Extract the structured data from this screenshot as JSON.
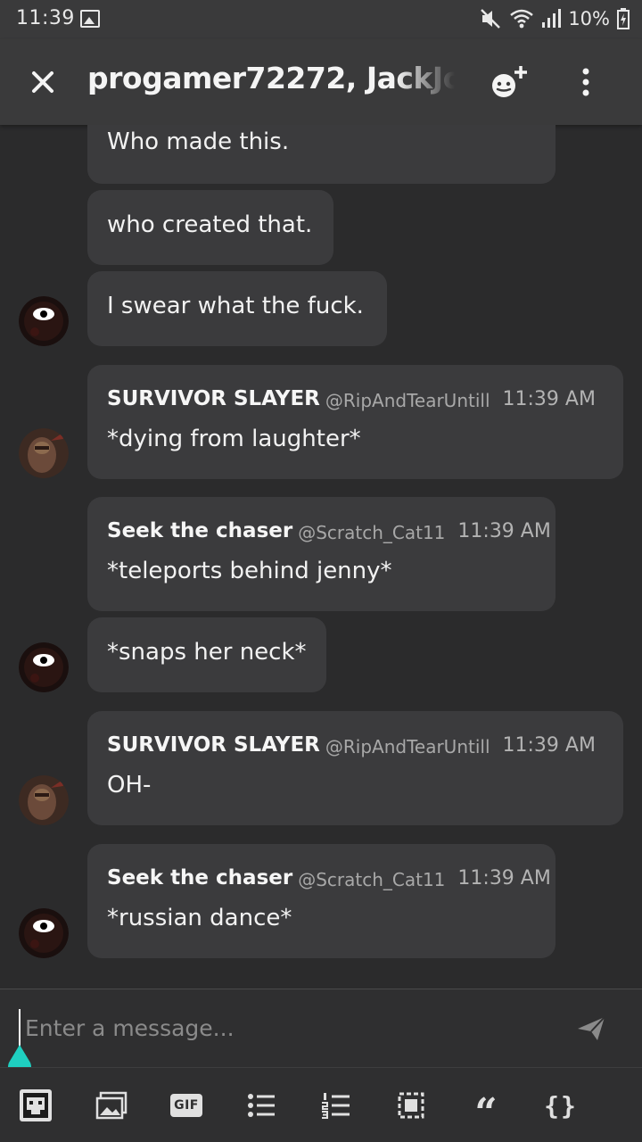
{
  "status_bar": {
    "time": "11:39",
    "battery": "10%"
  },
  "header": {
    "title": "progamer72272, JackJo",
    "icons": [
      "close-icon",
      "add-member-icon",
      "more-vert-icon"
    ]
  },
  "messages": [
    {
      "text": "Who made this."
    },
    {
      "text": "who created that."
    },
    {
      "text": "I swear what the fuck."
    },
    {
      "author": "SURVIVOR SLAYER",
      "handle": "@RipAndTearUntill",
      "time": "11:39 AM",
      "text": "*dying from laughter*"
    },
    {
      "author": "Seek the chaser",
      "handle": "@Scratch_Cat11",
      "time": "11:39 AM",
      "text": "*teleports behind jenny*"
    },
    {
      "text": "*snaps her neck*"
    },
    {
      "author": "SURVIVOR SLAYER",
      "handle": "@RipAndTearUntill",
      "time": "11:39 AM",
      "text": "OH-"
    },
    {
      "author": "Seek the chaser",
      "handle": "@Scratch_Cat11",
      "time": "11:39 AM",
      "text": "*russian dance*"
    }
  ],
  "composer": {
    "placeholder": "Enter a message...",
    "value": ""
  },
  "toolbar": {
    "gif_label": "GIF",
    "quote_label": "66",
    "code_label": "{}",
    "icons": [
      "avatar-icon",
      "image-icon",
      "gif-icon",
      "bullet-list-icon",
      "numbered-list-icon",
      "spoiler-icon",
      "quote-icon",
      "code-icon"
    ]
  },
  "colors": {
    "background": "#2b2b2c",
    "bar": "#3a3a3b",
    "bubble": "#3b3b3d",
    "accent_cursor": "#1fcfc0"
  }
}
